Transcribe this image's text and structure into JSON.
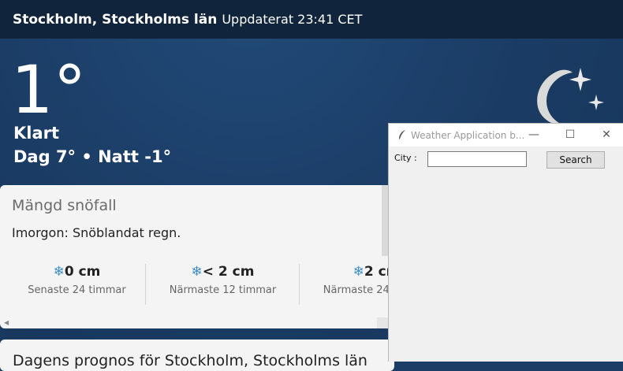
{
  "weather_app": {
    "location": "Stockholm, Stockholms län",
    "updated": "Uppdaterat 23:41 CET",
    "temperature": "1°",
    "condition": "Klart",
    "day_night": "Dag 7° • Natt -1°",
    "condition_icon": "moon-stars-icon",
    "snow_card": {
      "title": "Mängd snöfall",
      "subtitle": "Imorgon: Snöblandat regn.",
      "columns": [
        {
          "icon": "snowflake-icon",
          "value": "0 cm",
          "label": "Senaste 24 timmar"
        },
        {
          "icon": "snowflake-icon",
          "value": "< 2 cm",
          "label": "Närmaste 12 timmar"
        },
        {
          "icon": "snowflake-icon",
          "value": "2 cm",
          "label": "Närmaste 24 timmar"
        }
      ]
    },
    "forecast_card": {
      "title": "Dagens prognos för Stockholm, Stockholms län"
    }
  },
  "tk_window": {
    "title": "Weather Application b...",
    "minimize": "—",
    "maximize": "☐",
    "close": "✕",
    "city_label": "City :",
    "city_value": "",
    "search_label": "Search"
  },
  "colors": {
    "topbar": "#10243c",
    "background": "#1c3e66",
    "snow_accent": "#3c8dc8"
  }
}
